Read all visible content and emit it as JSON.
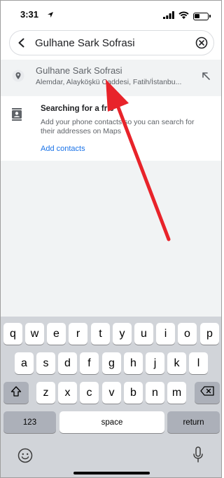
{
  "status": {
    "time": "3:31"
  },
  "search": {
    "value": "Gulhane Sark Sofrasi"
  },
  "suggestion": {
    "title": "Gulhane Sark Sofrasi",
    "subtitle": "Alemdar, Alayköşkü Caddesi, Fatih/İstanbu..."
  },
  "contacts": {
    "heading": "Searching for a frie",
    "description": "Add your phone contacts so you can search for their addresses on Maps",
    "link": "Add contacts"
  },
  "keyboard": {
    "row1": [
      "q",
      "w",
      "e",
      "r",
      "t",
      "y",
      "u",
      "i",
      "o",
      "p"
    ],
    "row2": [
      "a",
      "s",
      "d",
      "f",
      "g",
      "h",
      "j",
      "k",
      "l"
    ],
    "row3": [
      "z",
      "x",
      "c",
      "v",
      "b",
      "n",
      "m"
    ],
    "numbers_label": "123",
    "space_label": "space",
    "return_label": "return"
  },
  "colors": {
    "link": "#1a73e8",
    "arrow": "#e8232a",
    "keyboard_bg": "#d1d4d9"
  }
}
